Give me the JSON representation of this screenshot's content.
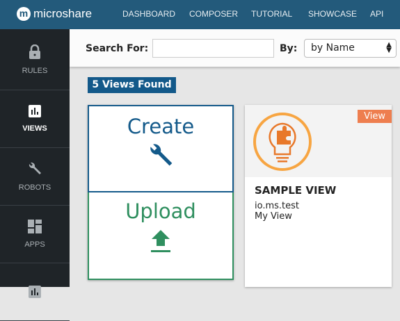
{
  "header": {
    "brand": "microshare",
    "nav": [
      "DASHBOARD",
      "COMPOSER",
      "TUTORIAL",
      "SHOWCASE",
      "API"
    ]
  },
  "sidebar": {
    "items": [
      {
        "label": "RULES",
        "icon": "lock-icon"
      },
      {
        "label": "VIEWS",
        "icon": "bar-chart-icon",
        "active": true
      },
      {
        "label": "ROBOTS",
        "icon": "wrench-icon"
      },
      {
        "label": "APPS",
        "icon": "dashboard-icon"
      },
      {
        "label": "",
        "icon": "bar-chart-icon"
      }
    ]
  },
  "search": {
    "label": "Search For:",
    "value": "",
    "by_label": "By:",
    "by_value": "by Name"
  },
  "results": {
    "count_label": "5 Views Found"
  },
  "create_card": {
    "create": "Create",
    "upload": "Upload"
  },
  "view_card": {
    "badge": "View",
    "title": "SAMPLE VIEW",
    "namespace": "io.ms.test",
    "description": "My View"
  },
  "colors": {
    "header": "#235a7b",
    "sidebar": "#1f2428",
    "primary": "#145a8a",
    "upload": "#2f8f5f",
    "accent": "#ee7e4f"
  }
}
